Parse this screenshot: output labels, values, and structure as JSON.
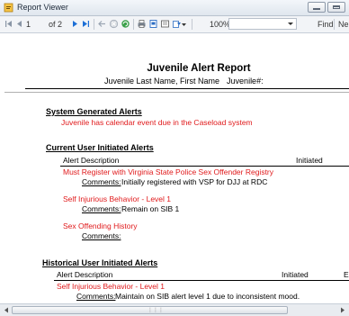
{
  "window": {
    "title": "Report Viewer"
  },
  "toolbar": {
    "page_current": "1",
    "page_total": "of 2",
    "zoom": "100%",
    "find_label": "Find",
    "next_label": "Ne"
  },
  "report": {
    "title": "Juvenile Alert Report",
    "subtitle": "Juvenile Last Name, First Name",
    "juvenile_label": "Juvenile#:",
    "system": {
      "heading": "System Generated Alerts",
      "alert": "Juvenile has calendar event due in the Caseload system"
    },
    "current": {
      "heading": "Current User Initiated Alerts",
      "col_description": "Alert Description",
      "col_initiated": "Initiated",
      "alerts": [
        {
          "title": "Must Register with Virginia State Police Sex Offender Registry",
          "comment_label": "Comments:",
          "comment": "Initially registered with VSP for DJJ at RDC"
        },
        {
          "title": "Self Injurious Behavior - Level 1",
          "comment_label": "Comments:",
          "comment": "Remain on SIB 1"
        },
        {
          "title": "Sex Offending History",
          "comment_label": "Comments:",
          "comment": ""
        }
      ]
    },
    "historical": {
      "heading": "Historical User Initiated Alerts",
      "col_description": "Alert Description",
      "col_initiated": "Initiated",
      "col_extra": "E",
      "alerts": [
        {
          "title": "Self Injurious Behavior - Level 1",
          "comment_label": "Comments:",
          "comment": "Maintain on SIB alert level 1 due to inconsistent mood."
        }
      ]
    }
  },
  "colors": {
    "alert_red": "#e0191b",
    "toolbar_bg": "#f2f4f7"
  },
  "icons": [
    "report-viewer-icon",
    "first-page-icon",
    "previous-page-icon",
    "next-page-icon",
    "last-page-icon",
    "back-icon",
    "stop-icon",
    "refresh-icon",
    "print-icon",
    "print-layout-icon",
    "page-setup-icon",
    "export-icon"
  ]
}
